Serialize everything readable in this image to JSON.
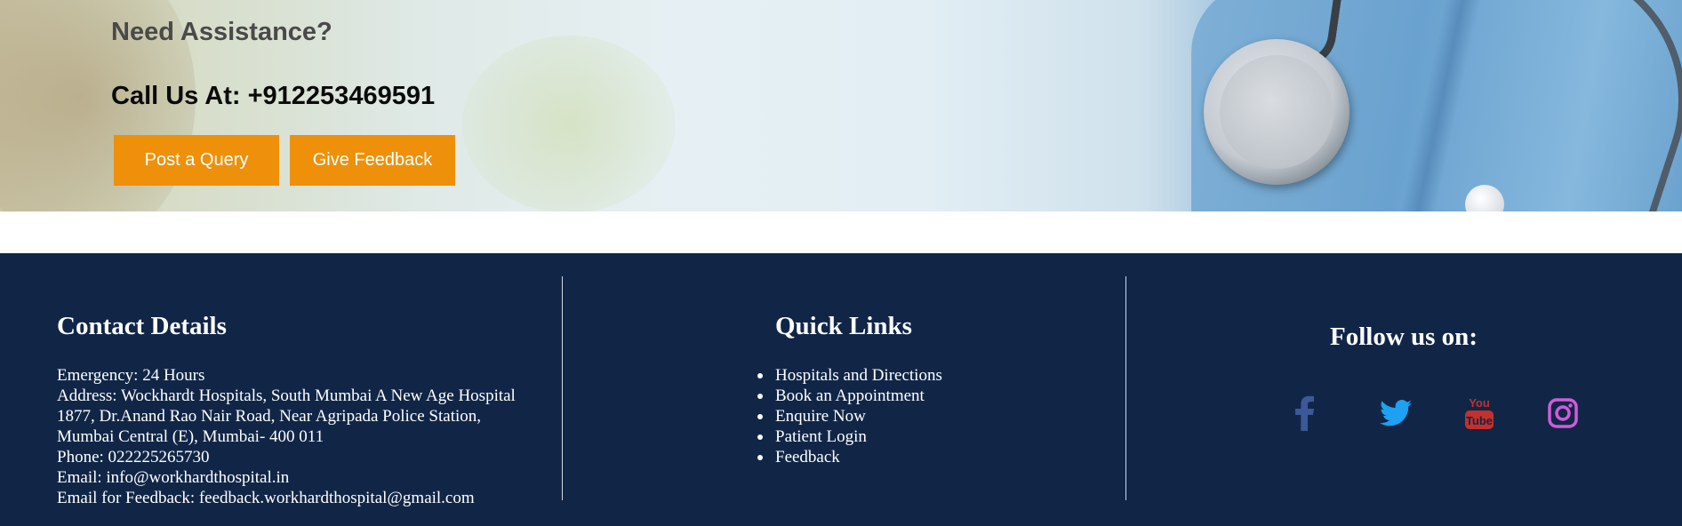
{
  "hero": {
    "heading": "Need Assistance?",
    "call_text": "Call Us At: +912253469591",
    "buttons": {
      "query": "Post a Query",
      "feedback": "Give Feedback"
    }
  },
  "contact": {
    "title": "Contact Details",
    "lines": [
      "Emergency: 24 Hours",
      "Address: Wockhardt Hospitals, South Mumbai A New Age Hospital",
      "1877, Dr.Anand Rao Nair Road, Near Agripada Police Station,",
      "Mumbai Central (E), Mumbai- 400 011",
      "Phone: 022225265730",
      "Email: info@workhardthospital.in",
      "Email for Feedback: feedback.workhardthospital@gmail.com"
    ]
  },
  "quick_links": {
    "title": "Quick Links",
    "items": [
      "Hospitals and Directions",
      "Book an Appointment",
      "Enquire Now",
      "Patient Login",
      "Feedback"
    ]
  },
  "follow": {
    "title": "Follow us on:",
    "icons": [
      "facebook-icon",
      "twitter-icon",
      "youtube-icon",
      "instagram-icon"
    ],
    "youtube_logo_text": [
      "You",
      "Tube"
    ]
  },
  "colors": {
    "button_orange": "#ee900a",
    "footer_navy": "#112647",
    "facebook": "#3b5998",
    "twitter": "#1da1f2",
    "youtube": "#c4302b",
    "instagram": "#c13584"
  }
}
